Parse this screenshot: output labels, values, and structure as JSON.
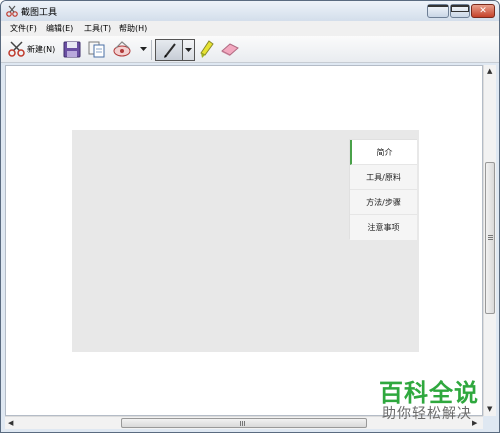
{
  "window": {
    "title": "截图工具"
  },
  "menu": {
    "items": [
      "文件(F)",
      "编辑(E)",
      "工具(T)",
      "帮助(H)"
    ]
  },
  "toolbar": {
    "new_label": "新建(N)"
  },
  "content_nav": {
    "items": [
      "简介",
      "工具/原料",
      "方法/步骤",
      "注意事项"
    ],
    "active_index": 0
  },
  "watermark": {
    "title": "百科全说",
    "subtitle": "助你轻松解决"
  },
  "colors": {
    "accent_green": "#2fa83e",
    "active_tab_border": "#4aa14a"
  }
}
